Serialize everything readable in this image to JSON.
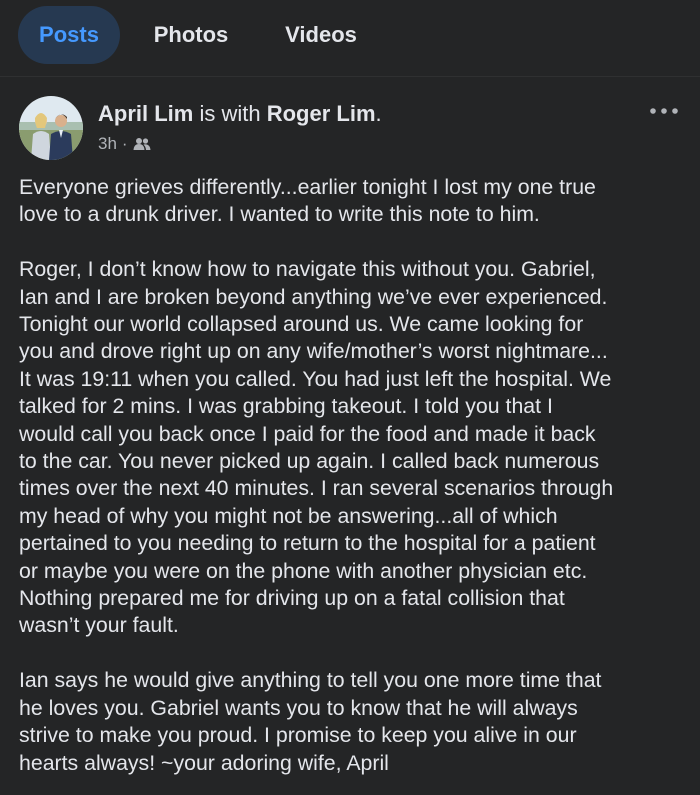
{
  "tabs": [
    {
      "label": "Posts",
      "active": true
    },
    {
      "label": "Photos",
      "active": false
    },
    {
      "label": "Videos",
      "active": false
    }
  ],
  "post": {
    "author": "April Lim",
    "with_text": "is with",
    "tagged": "Roger Lim",
    "time": "3h",
    "audience_icon": "friends-icon",
    "menu_icon": "more-options-icon",
    "paragraphs": [
      [
        "Everyone grieves differently...earlier tonight I lost my one true",
        "love to a drunk driver. I wanted to write this note to him."
      ],
      [
        "Roger, I don’t know how to navigate this without you. Gabriel,",
        "Ian and I are broken beyond anything we’ve ever experienced.",
        "Tonight our world collapsed around us. We came looking for",
        "you and drove right up on any wife/mother’s worst nightmare...",
        "It was 19:11 when you called. You had just left the hospital. We",
        "talked for 2 mins. I was grabbing takeout. I told you that I",
        "would call you back once I paid for the food and made it back",
        "to the car. You never picked up again. I called back numerous",
        "times over the next 40 minutes. I ran several scenarios through",
        "my head of why you might not be answering...all of which",
        "pertained to you needing to return to the hospital for a patient",
        "or maybe you were on the phone with another physician etc.",
        "Nothing prepared me for driving up on a fatal collision that",
        "wasn’t your fault."
      ],
      [
        "Ian says he would give anything to tell you one more time that",
        "he loves you. Gabriel wants you to know that he will always",
        "strive to make you proud. I promise to keep you alive in our",
        "hearts always! ~your adoring wife, April"
      ]
    ]
  },
  "colors": {
    "background": "#242526",
    "text": "#e4e6eb",
    "secondary_text": "#b0b3b8",
    "active_tab_bg": "#263951",
    "active_tab_text": "#4599ff"
  }
}
